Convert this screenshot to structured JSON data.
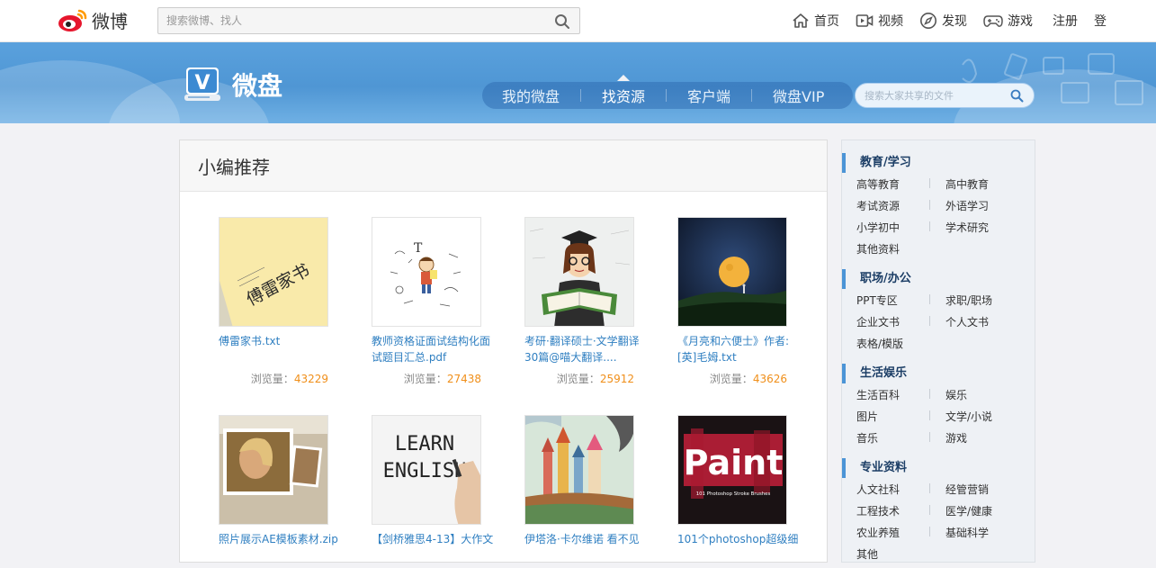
{
  "topbar": {
    "logo_text": "微博",
    "search_placeholder": "搜索微博、找人",
    "nav": [
      {
        "label": "首页",
        "icon": "home-icon"
      },
      {
        "label": "视频",
        "icon": "video-icon"
      },
      {
        "label": "发现",
        "icon": "compass-icon"
      },
      {
        "label": "游戏",
        "icon": "gamepad-icon"
      }
    ],
    "register_label": "注册",
    "login_label": "登"
  },
  "banner": {
    "brand_text": "微盘",
    "logo_letter": "V",
    "tabs": [
      {
        "label": "我的微盘",
        "active": false
      },
      {
        "label": "找资源",
        "active": true
      },
      {
        "label": "客户端",
        "active": false
      },
      {
        "label": "微盘VIP",
        "active": false
      }
    ],
    "file_search_placeholder": "搜索大家共享的文件"
  },
  "main": {
    "title": "小编推荐",
    "views_label": "浏览量：",
    "items": [
      {
        "name": "傅雷家书.txt",
        "views": "43229",
        "thumb": "book-cover-yellow"
      },
      {
        "name": "教师资格证面试结构化面试题目汇总.pdf",
        "views": "27438",
        "thumb": "teacher-doodle"
      },
      {
        "name": "考研·翻译硕士·文学翻译30篇@喵大翻译....",
        "views": "25912",
        "thumb": "graduate-cartoon"
      },
      {
        "name": "《月亮和六便士》作者:[英]毛姆.txt",
        "views": "43626",
        "thumb": "moon-night"
      },
      {
        "name": "照片展示AE模板素材.zip",
        "views": "",
        "thumb": "photo-slides"
      },
      {
        "name": "【剑桥雅思4-13】大作文",
        "views": "",
        "thumb": "learn-english"
      },
      {
        "name": "伊塔洛·卡尔维诺 看不见",
        "views": "",
        "thumb": "fantasy-city"
      },
      {
        "name": "101个photoshop超级细",
        "views": "",
        "thumb": "paint-brushes"
      }
    ],
    "learn_text_1": "LEARN",
    "learn_text_2": "ENGLISH",
    "paint_text": "Paint",
    "paint_sub": "101 Photoshop Stroke Brushes",
    "book_text": "傅雷家书"
  },
  "sidebar": {
    "categories": [
      {
        "title": "教育/学习",
        "items": [
          "高等教育",
          "高中教育",
          "考试资源",
          "外语学习",
          "小学初中",
          "学术研究",
          "其他资料"
        ]
      },
      {
        "title": "职场/办公",
        "items": [
          "PPT专区",
          "求职/职场",
          "企业文书",
          "个人文书",
          "表格/模版"
        ]
      },
      {
        "title": "生活娱乐",
        "items": [
          "生活百科",
          "娱乐",
          "图片",
          "文学/小说",
          "音乐",
          "游戏"
        ]
      },
      {
        "title": "专业资料",
        "items": [
          "人文社科",
          "经管营销",
          "工程技术",
          "医学/健康",
          "农业养殖",
          "基础科学",
          "其他"
        ]
      }
    ]
  },
  "colors": {
    "link_blue": "#2f7fc1",
    "views_orange": "#f08f1a",
    "banner_blue": "#5aa1dd",
    "sidebar_accent": "#4b94d6"
  }
}
